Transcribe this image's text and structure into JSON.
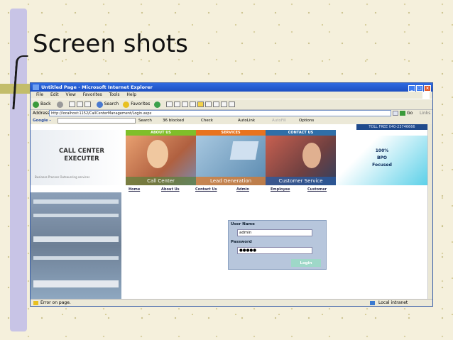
{
  "slide": {
    "title": "Screen shots"
  },
  "window": {
    "title": "Untitled Page - Microsoft Internet Explorer",
    "menu": [
      "File",
      "Edit",
      "View",
      "Favorites",
      "Tools",
      "Help"
    ],
    "toolbar": {
      "back": "Back",
      "search": "Search",
      "favorites": "Favorites"
    },
    "address_label": "Address",
    "address_value": "http://localhost:1152/CallCenterManagement/Login.aspx",
    "go_label": "Go",
    "links_label": "Links",
    "google": {
      "label": "Google -",
      "search": "Search",
      "blocked": "36 blocked",
      "check": "Check",
      "autolink": "AutoLink",
      "autofill": "AutoFill",
      "options": "Options"
    },
    "status": {
      "left": "Error on page.",
      "right": "Local intranet"
    }
  },
  "site": {
    "toll_free": "TOLL FREE 040-23746666",
    "nav_tabs": [
      "ABOUT US",
      "SERVICES",
      "CONTACT US"
    ],
    "logo_line1": "CALL CENTER",
    "logo_line2": "EXECUTER",
    "logo_sub": "Business Process Outsourcing services",
    "panels": [
      "Call Center",
      "Lead Generation",
      "Customer Service"
    ],
    "bpo": [
      "100%",
      "BPO",
      "Focused"
    ],
    "links": [
      "Home",
      "About Us",
      "Contact Us",
      "Admin",
      "Employee",
      "Customer"
    ],
    "login": {
      "username_label": "User Name",
      "username_value": "admin",
      "password_label": "Password",
      "password_value": "●●●●●",
      "button": "Login"
    }
  },
  "colors": {
    "tab_about": "#7fbf2a",
    "tab_services": "#e8731e",
    "tab_contact": "#2f6fa8",
    "panel_caption": "#4a7fb0"
  }
}
